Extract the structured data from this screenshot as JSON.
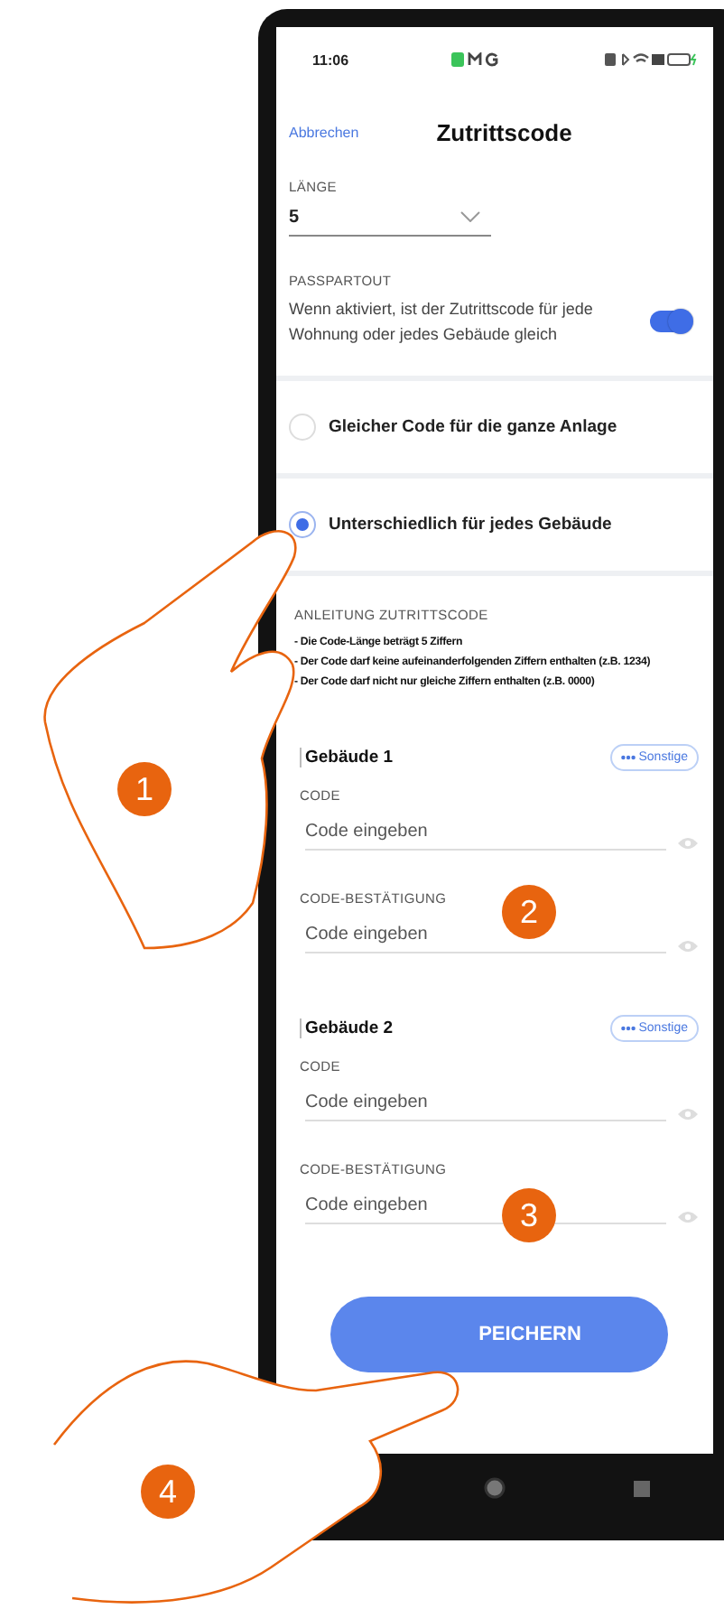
{
  "status_bar": {
    "time": "11:06"
  },
  "header": {
    "cancel": "Abbrechen",
    "title": "Zutrittscode"
  },
  "length": {
    "label": "LÄNGE",
    "value": "5"
  },
  "passpartout": {
    "label": "PASSPARTOUT",
    "description": "Wenn aktiviert, ist der Zutrittscode für jede Wohnung oder jedes Gebäude gleich",
    "on": true
  },
  "options": [
    {
      "label": "Gleicher Code für die ganze Anlage",
      "selected": false
    },
    {
      "label": "Unterschiedlich für jedes Gebäude",
      "selected": true
    }
  ],
  "instructions": {
    "title": "ANLEITUNG ZUTRITTSCODE",
    "lines": [
      "- Die Code-Länge beträgt 5 Ziffern",
      "- Der Code darf keine aufeinanderfolgenden Ziffern enthalten (z.B. 1234)",
      "- Der Code darf nicht nur gleiche Ziffern enthalten (z.B. 0000)"
    ]
  },
  "buildings": [
    {
      "name": "Gebäude 1",
      "more_button": "Sonstige",
      "fields": [
        {
          "label": "CODE",
          "placeholder": "Code eingeben"
        },
        {
          "label": "CODE-BESTÄTIGUNG",
          "placeholder": "Code eingeben"
        }
      ]
    },
    {
      "name": "Gebäude 2",
      "more_button": "Sonstige",
      "fields": [
        {
          "label": "CODE",
          "placeholder": "Code eingeben"
        },
        {
          "label": "CODE-BESTÄTIGUNG",
          "placeholder": "Code eingeben"
        }
      ]
    }
  ],
  "save_button": "PEICHERN",
  "callouts": [
    "1",
    "2",
    "3",
    "4"
  ]
}
